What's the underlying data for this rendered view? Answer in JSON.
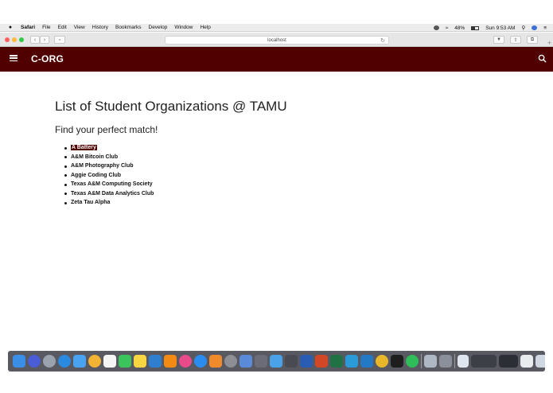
{
  "menubar": {
    "app_name": "Safari",
    "items": [
      "File",
      "Edit",
      "View",
      "History",
      "Bookmarks",
      "Develop",
      "Window",
      "Help"
    ],
    "battery": "48%",
    "clock": "Sun 9:53 AM"
  },
  "browser": {
    "address": "localhost"
  },
  "header": {
    "brand": "C-ORG",
    "color": "#500000"
  },
  "main": {
    "title": "List of Student Organizations @ TAMU",
    "subtitle": "Find your perfect match!",
    "organizations": [
      "A Battery",
      "A&M Bitcoin Club",
      "A&M Photography Club",
      "Aggie Coding Club",
      "Texas A&M Computing Society",
      "Texas A&M Data Analytics Club",
      "Zeta Tau Alpha"
    ],
    "selected": "A Battery"
  }
}
